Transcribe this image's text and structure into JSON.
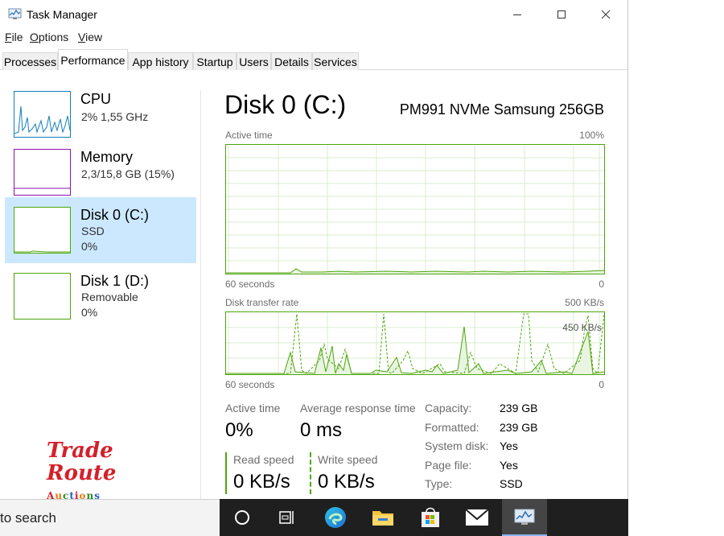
{
  "window": {
    "title": "Task Manager"
  },
  "menu": [
    {
      "accel": "F",
      "rest": "ile"
    },
    {
      "accel": "O",
      "rest": "ptions"
    },
    {
      "accel": "V",
      "rest": "iew"
    }
  ],
  "tabs": [
    "Processes",
    "Performance",
    "App history",
    "Startup",
    "Users",
    "Details",
    "Services"
  ],
  "active_tab": "Performance",
  "sidebar": {
    "items": [
      {
        "name": "CPU",
        "line1": "2%  1,55 GHz",
        "line2": "",
        "color": "#117dbb",
        "selected": false
      },
      {
        "name": "Memory",
        "line1": "2,3/15,8 GB (15%)",
        "line2": "",
        "color": "#8b12ae",
        "selected": false
      },
      {
        "name": "Disk 0 (C:)",
        "line1": "SSD",
        "line2": "0%",
        "color": "#4da60c",
        "selected": true
      },
      {
        "name": "Disk 1 (D:)",
        "line1": "Removable",
        "line2": "0%",
        "color": "#4da60c",
        "selected": false
      }
    ]
  },
  "main": {
    "title": "Disk 0 (C:)",
    "model": "PM991 NVMe Samsung 256GB",
    "graph1": {
      "label": "Active time",
      "max": "100%",
      "time": "60 seconds",
      "min": "0"
    },
    "graph2": {
      "label": "Disk transfer rate",
      "max": "500 KB/s",
      "mid": "450 KB/s",
      "time": "60 seconds",
      "min": "0"
    },
    "stats": {
      "active_time_label": "Active time",
      "active_time_value": "0%",
      "response_label": "Average response time",
      "response_value": "0 ms",
      "read_label": "Read speed",
      "read_value": "0 KB/s",
      "write_label": "Write speed",
      "write_value": "0 KB/s"
    },
    "info": [
      {
        "label": "Capacity:",
        "value": "239 GB"
      },
      {
        "label": "Formatted:",
        "value": "239 GB"
      },
      {
        "label": "System disk:",
        "value": "Yes"
      },
      {
        "label": "Page file:",
        "value": "Yes"
      },
      {
        "label": "Type:",
        "value": "SSD"
      }
    ],
    "accent_color": "#4da60c"
  },
  "watermark": {
    "line1": "Trade",
    "line2": "Route",
    "line3": "Auctions"
  },
  "taskbar": {
    "search_text": "to search",
    "icons": [
      "task-view-circle-icon",
      "timeline-icon",
      "edge-icon",
      "file-explorer-icon",
      "store-icon",
      "mail-icon",
      "task-manager-icon"
    ]
  }
}
